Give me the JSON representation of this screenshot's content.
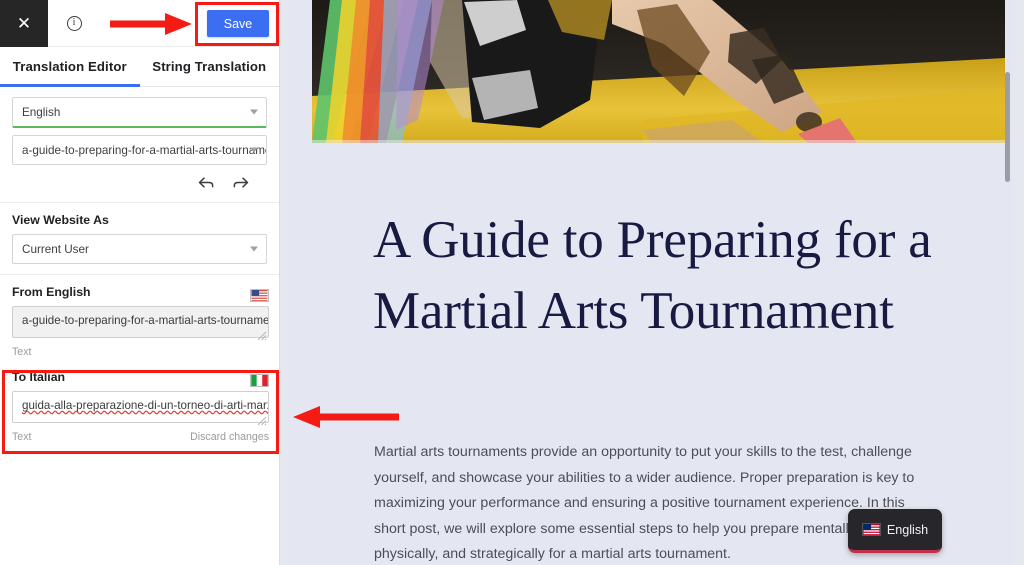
{
  "sidebar": {
    "topbar": {
      "close_icon": "close-icon",
      "close_glyph": "✕",
      "info_icon": "info-icon",
      "info_glyph": "i",
      "save_label": "Save",
      "save_color": "#3b6ef0"
    },
    "tabs": [
      {
        "label": "Translation Editor",
        "active": true
      },
      {
        "label": "String Translation",
        "active": false
      }
    ],
    "language_select": {
      "value": "English",
      "accent_color": "#5cb85c"
    },
    "slug_select": {
      "value": "a-guide-to-preparing-for-a-martial-arts-tournament"
    },
    "history": {
      "undo_icon": "undo-icon",
      "redo_icon": "redo-icon"
    },
    "view_as": {
      "label": "View Website As",
      "select_value": "Current User"
    },
    "source": {
      "label": "From English",
      "flag_icon": "us-flag-icon",
      "value": "a-guide-to-preparing-for-a-martial-arts-tournament",
      "field_type": "Text"
    },
    "target": {
      "label": "To Italian",
      "flag_icon": "it-flag-icon",
      "value": "guida-alla-preparazione-di-un-torneo-di-arti-marziali",
      "field_type": "Text",
      "discard_label": "Discard changes",
      "spellcheck_underline_color": "#e03a2f"
    }
  },
  "content": {
    "hero_image_alt": "martial artist on yellow mat",
    "title": "A Guide to Preparing for a Martial Arts Tournament",
    "body": "Martial arts tournaments provide an opportunity to put your skills to the test, challenge yourself, and showcase your abilities to a wider audience. Proper preparation is key to maximizing your performance and ensuring a positive tournament experience. In this short post, we will explore some essential steps to help you prepare mentally, physically, and strategically for a martial arts tournament.",
    "title_color": "#181a42",
    "background_color": "#e4e7f1",
    "language_switcher": {
      "label": "English",
      "flag_icon": "us-flag-icon",
      "background_color": "#27262b",
      "underline_color": "#c0304a"
    }
  },
  "annotations": {
    "color": "#f41b15",
    "highlight_save_button": true,
    "highlight_italian_field": true,
    "arrow_to_save": "right-arrow",
    "arrow_to_italian_field": "left-arrow"
  }
}
